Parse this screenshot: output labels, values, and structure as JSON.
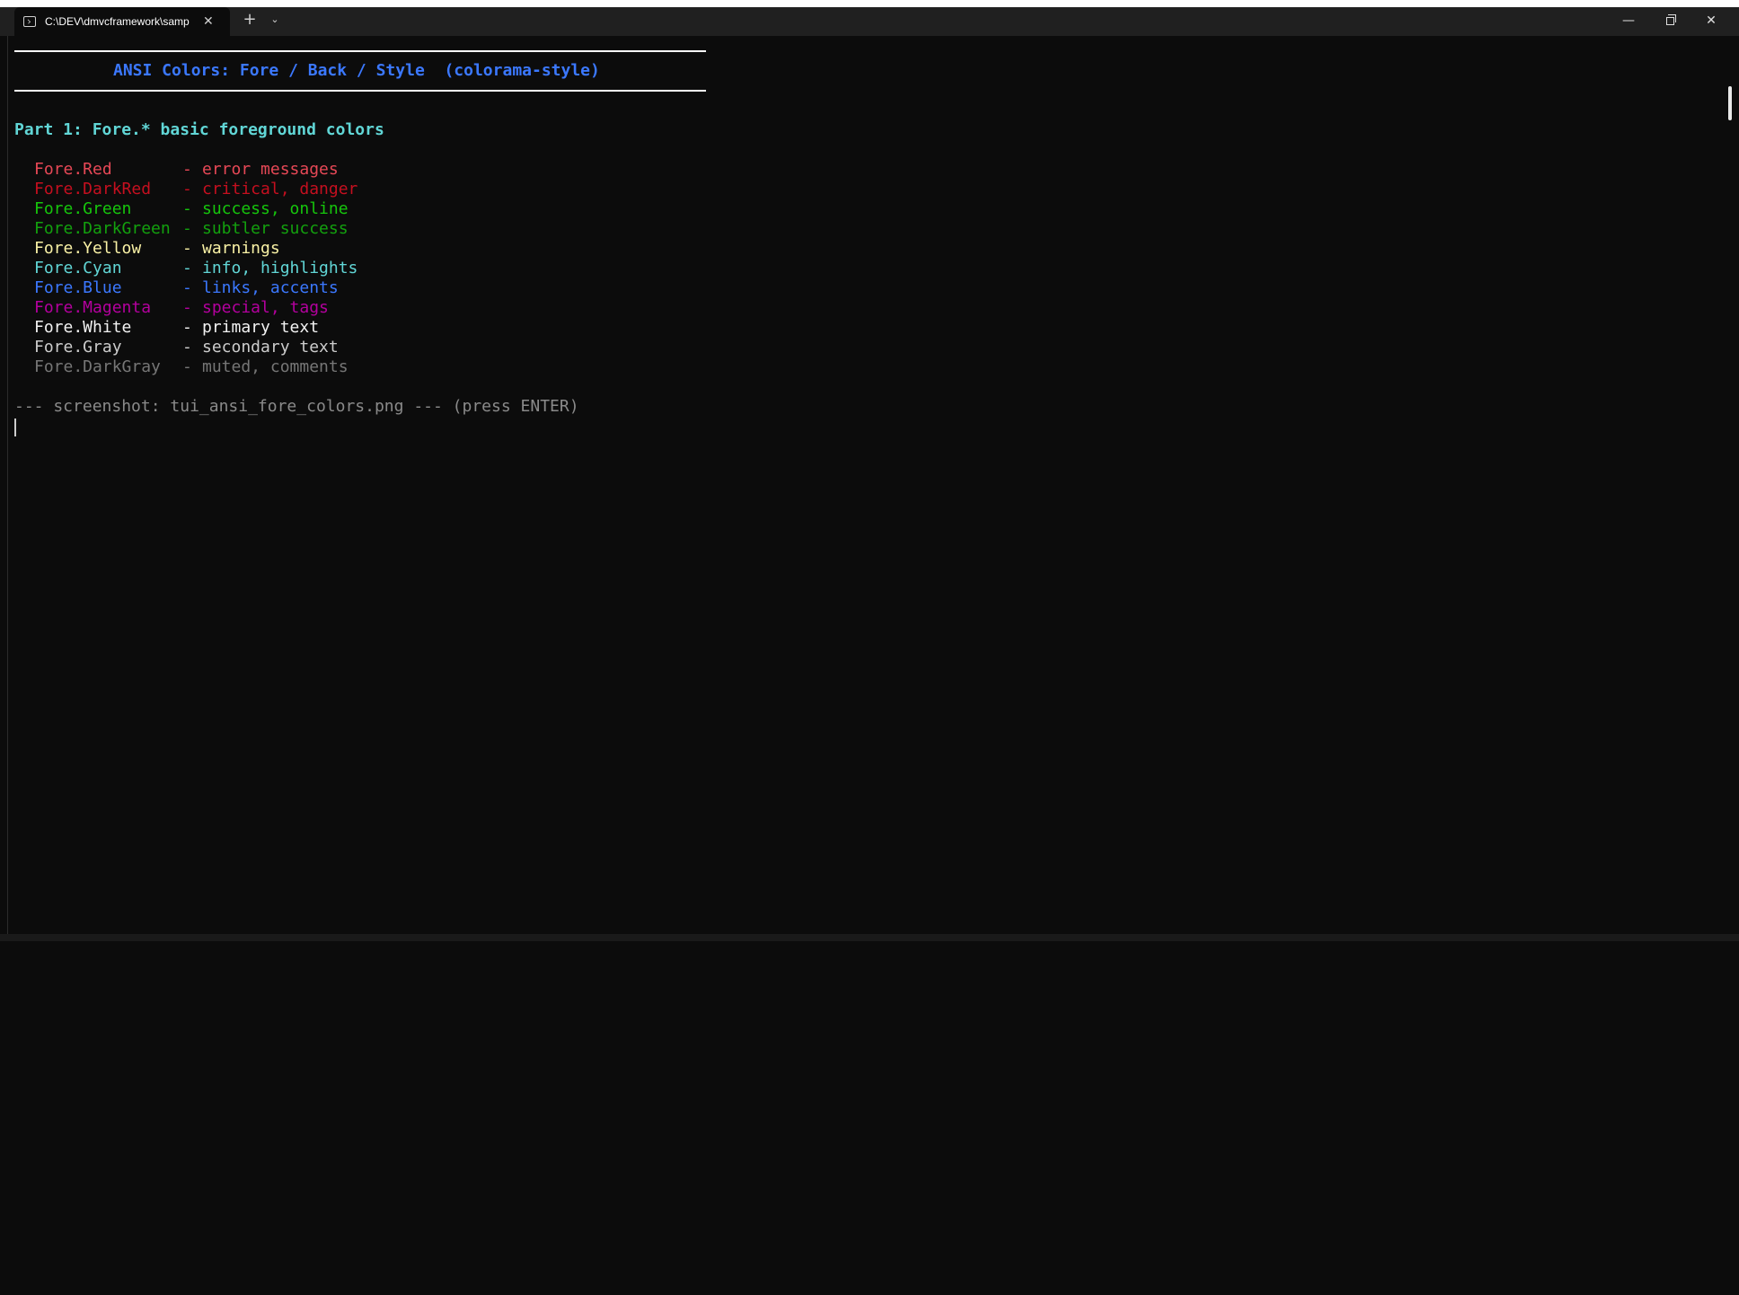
{
  "window": {
    "tab_title": "C:\\DEV\\dmvcframework\\samp",
    "tab_close": "✕",
    "new_tab": "+",
    "dropdown": "⌄",
    "minimize": "—",
    "close": "✕",
    "terminal_icon": "terminal-icon"
  },
  "terminal": {
    "banner": "ANSI Colors: Fore / Back / Style  (colorama-style)",
    "part_heading": "Part 1: Fore.* basic foreground colors",
    "rows": [
      {
        "name": "Fore.Red",
        "sep": "-",
        "desc": "error messages",
        "color": "#e74856"
      },
      {
        "name": "Fore.DarkRed",
        "sep": "-",
        "desc": "critical, danger",
        "color": "#c50f1f"
      },
      {
        "name": "Fore.Green",
        "sep": "-",
        "desc": "success, online",
        "color": "#16c60c"
      },
      {
        "name": "Fore.DarkGreen",
        "sep": "-",
        "desc": "subtler success",
        "color": "#13a10e"
      },
      {
        "name": "Fore.Yellow",
        "sep": "-",
        "desc": "warnings",
        "color": "#f9f1a5"
      },
      {
        "name": "Fore.Cyan",
        "sep": "-",
        "desc": "info, highlights",
        "color": "#61d6d6"
      },
      {
        "name": "Fore.Blue",
        "sep": "-",
        "desc": "links, accents",
        "color": "#3b78ff"
      },
      {
        "name": "Fore.Magenta",
        "sep": "-",
        "desc": "special, tags",
        "color": "#b4009e"
      },
      {
        "name": "Fore.White",
        "sep": "-",
        "desc": "primary text",
        "color": "#f2f2f2"
      },
      {
        "name": "Fore.Gray",
        "sep": "-",
        "desc": "secondary text",
        "color": "#cccccc"
      },
      {
        "name": "Fore.DarkGray",
        "sep": "-",
        "desc": "muted, comments",
        "color": "#767676"
      }
    ],
    "footer": "--- screenshot: tui_ansi_fore_colors.png --- (press ENTER)"
  },
  "colors": {
    "background": "#0c0c0c",
    "titlebar": "#202020",
    "banner": "#3b78ff",
    "heading": "#61d6d6",
    "muted": "#8a8a8a"
  }
}
